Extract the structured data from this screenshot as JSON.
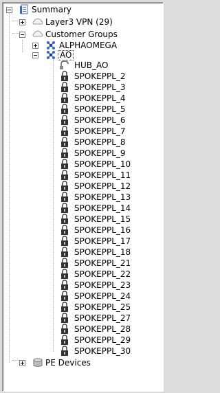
{
  "tree": {
    "root": {
      "label": "Summary",
      "icon": "summary-document-icon",
      "expanded": true
    },
    "layer3": {
      "label": "Layer3 VPN (29)",
      "icon": "cloud-icon",
      "expanded": false
    },
    "customer_groups": {
      "label": "Customer Groups",
      "icon": "cloud-icon",
      "expanded": true
    },
    "alphaomega": {
      "label": "ALPHAOMEGA",
      "icon": "group-star-icon",
      "expanded": false
    },
    "ao": {
      "label": "AO",
      "icon": "group-star-icon",
      "expanded": true,
      "selected": true
    },
    "hub": {
      "label": "HUB_AO",
      "icon": "hub-icon"
    },
    "spokes": [
      "SPOKEPPL_2",
      "SPOKEPPL_3",
      "SPOKEPPL_4",
      "SPOKEPPL_5",
      "SPOKEPPL_6",
      "SPOKEPPL_7",
      "SPOKEPPL_8",
      "SPOKEPPL_9",
      "SPOKEPPL_10",
      "SPOKEPPL_11",
      "SPOKEPPL_12",
      "SPOKEPPL_13",
      "SPOKEPPL_14",
      "SPOKEPPL_15",
      "SPOKEPPL_16",
      "SPOKEPPL_17",
      "SPOKEPPL_18",
      "SPOKEPPL_21",
      "SPOKEPPL_22",
      "SPOKEPPL_23",
      "SPOKEPPL_24",
      "SPOKEPPL_25",
      "SPOKEPPL_27",
      "SPOKEPPL_28",
      "SPOKEPPL_29",
      "SPOKEPPL_30"
    ],
    "spoke_icon": "lock-icon",
    "pe_devices": {
      "label": "PE Devices",
      "icon": "database-icon",
      "expanded": false
    }
  }
}
